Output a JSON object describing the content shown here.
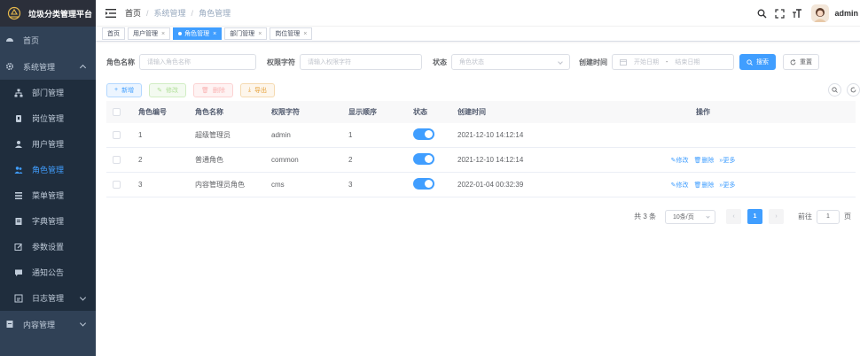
{
  "app": {
    "title": "垃圾分类管理平台"
  },
  "sidebar": {
    "items": [
      {
        "label": "首页"
      },
      {
        "label": "系统管理"
      },
      {
        "label": "部门管理"
      },
      {
        "label": "岗位管理"
      },
      {
        "label": "用户管理"
      },
      {
        "label": "角色管理"
      },
      {
        "label": "菜单管理"
      },
      {
        "label": "字典管理"
      },
      {
        "label": "参数设置"
      },
      {
        "label": "通知公告"
      },
      {
        "label": "日志管理"
      },
      {
        "label": "内容管理"
      }
    ]
  },
  "navbar": {
    "breadcrumb": [
      "首页",
      "系统管理",
      "角色管理"
    ],
    "separator": "/",
    "username": "admin"
  },
  "tags": [
    {
      "label": "首页"
    },
    {
      "label": "用户管理",
      "close": "×"
    },
    {
      "label": "角色管理",
      "close": "×"
    },
    {
      "label": "部门管理",
      "close": "×"
    },
    {
      "label": "岗位管理",
      "close": "×"
    }
  ],
  "search": {
    "role_name_label": "角色名称",
    "role_name_placeholder": "请输入角色名称",
    "role_key_label": "权限字符",
    "role_key_placeholder": "请输入权限字符",
    "status_label": "状态",
    "status_placeholder": "角色状态",
    "time_label": "创建时间",
    "start_placeholder": "开始日期",
    "range_sep": "-",
    "end_placeholder": "结束日期",
    "search_btn": "搜索",
    "reset_btn": "重置"
  },
  "toolbar": {
    "add": "新增",
    "edit": "修改",
    "delete": "删除",
    "export": "导出"
  },
  "table": {
    "columns": [
      "角色编号",
      "角色名称",
      "权限字符",
      "显示顺序",
      "状态",
      "创建时间",
      "操作"
    ],
    "rows": [
      {
        "id": "1",
        "name": "超级管理员",
        "key": "admin",
        "sort": "1",
        "status": true,
        "time": "2021-12-10 14:12:14",
        "ops": []
      },
      {
        "id": "2",
        "name": "普通角色",
        "key": "common",
        "sort": "2",
        "status": true,
        "time": "2021-12-10 14:12:14",
        "ops": [
          "修改",
          "删除",
          "更多"
        ]
      },
      {
        "id": "3",
        "name": "内容管理员角色",
        "key": "cms",
        "sort": "3",
        "status": true,
        "time": "2022-01-04 00:32:39",
        "ops": [
          "修改",
          "删除",
          "更多"
        ]
      }
    ]
  },
  "pagination": {
    "total_text": "共 3 条",
    "page_size": "10条/页",
    "current_page": "1",
    "goto_label": "前往",
    "goto_value": "1",
    "page_suffix": "页"
  },
  "colors": {
    "sidebar_bg": "#304156",
    "primary": "#409eff",
    "active_menu": "#409eff"
  }
}
